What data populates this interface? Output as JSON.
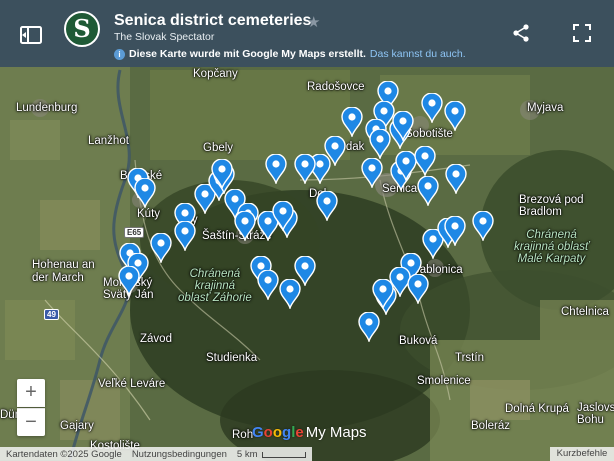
{
  "header": {
    "title": "Senica district cemeteries",
    "subtitle": "The Slovak Spectator",
    "logo_letter": "S",
    "notice_text": "Diese Karte wurde mit Google My Maps erstellt.",
    "notice_link": "Das kannst du auch.",
    "star_glyph": "★"
  },
  "map": {
    "places": {
      "kopcany": "Kopčany",
      "radosovce": "Radošovce",
      "myjava": "Myjava",
      "lundenburg": "Lundenburg",
      "lanzhot": "Lanžhot",
      "gbely": "Gbely",
      "sobotiste": "Sobotište",
      "brodske": "Brodské",
      "kuty": "Kúty",
      "senica": "Senica",
      "brezova": "Brezová pod\nBradlom",
      "hohenau": "Hohenau an\nder March",
      "sastin": "Šaštín-Stráže",
      "jablonica": "Jablonica",
      "moravsky": "Moravský\nSväty Ján",
      "chelnica": "Chtelnica",
      "zavod": "Závod",
      "bukova": "Buková",
      "studienka": "Studienka",
      "trstin": "Trstín",
      "velke_levare": "Veľké Leváre",
      "smolenice": "Smolenice",
      "gajary": "Gajary",
      "dolna_krupa": "Dolná Krupá",
      "jaslovske": "Jaslovs\nBohu",
      "kostolište": "Kostolište",
      "boleraz": "Boleráz",
      "rohoznik": "Roh",
      "durnkrut": "Dür",
      "dubovce": "Dol",
      "pardak": "rdak",
      "nr": "ry"
    },
    "protected_areas": {
      "zahorie": "Chránená\nkrajinná\noblasť Záhorie",
      "male_karpaty": "Chránená\nkrajinná oblasť\nMalé Karpaty"
    },
    "road_shields": {
      "e65": "E65",
      "r49": "49"
    },
    "marker_color": "#1e88e5",
    "marker_count": 52
  },
  "controls": {
    "zoom_in": "+",
    "zoom_out": "−"
  },
  "footer": {
    "brand_letters": [
      "G",
      "o",
      "o",
      "g",
      "l",
      "e"
    ],
    "brand_suffix": "My Maps",
    "map_data": "Kartendaten ©2025 Google",
    "terms": "Nutzungsbedingungen",
    "scale_label": "5 km",
    "shortcuts": "Kurzbefehle"
  }
}
